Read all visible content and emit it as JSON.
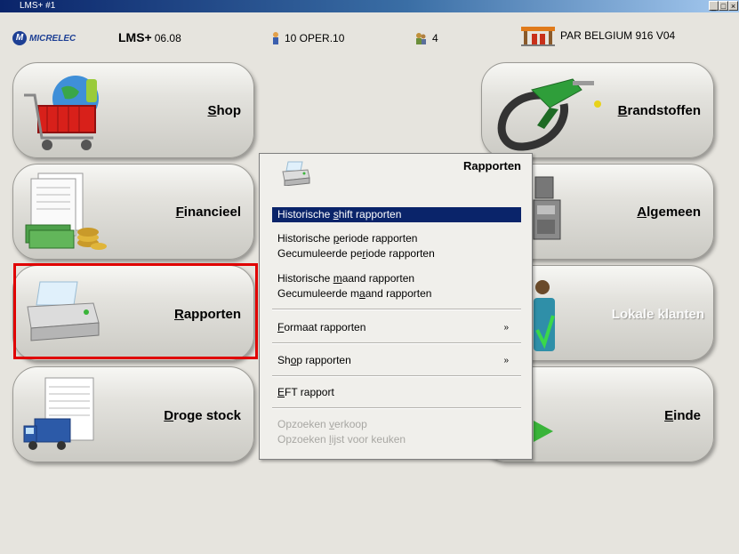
{
  "window": {
    "title": "LMS+  #1",
    "minimize": "_",
    "maximize": "□",
    "close": "×"
  },
  "header": {
    "logo_text": "MICRELEC",
    "logo_letter": "M",
    "product": "LMS+",
    "version": "06.08",
    "operator": "10  OPER.10",
    "pump_count": "4",
    "station": "PAR BELGIUM 916 V04"
  },
  "tiles": {
    "shop": {
      "pre": "",
      "key": "S",
      "post": "hop"
    },
    "financieel": {
      "pre": "",
      "key": "F",
      "post": "inancieel"
    },
    "rapporten": {
      "pre": "",
      "key": "R",
      "post": "apporten"
    },
    "droge_stock": {
      "pre": "",
      "key": "D",
      "post": "roge stock"
    },
    "brandstoffen": {
      "pre": "",
      "key": "B",
      "post": "randstoffen"
    },
    "algemeen": {
      "pre": "",
      "key": "A",
      "post": "lgemeen"
    },
    "lokale_klanten": {
      "label": "Lokale klanten"
    },
    "einde": {
      "pre": "",
      "key": "E",
      "post": "inde"
    }
  },
  "menu": {
    "title": "Rapporten",
    "items": [
      {
        "pre": "Historische ",
        "key": "s",
        "post": "hift rapporten"
      },
      {
        "pre": "Historische ",
        "key": "p",
        "post": "eriode rapporten"
      },
      {
        "pre": "Gecumuleerde pe",
        "key": "r",
        "post": "iode rapporten"
      },
      {
        "pre": "Historische ",
        "key": "m",
        "post": "aand rapporten"
      },
      {
        "pre": "Gecumuleerde m",
        "key": "a",
        "post": "and rapporten"
      },
      {
        "pre": "",
        "key": "F",
        "post": "ormaat rapporten",
        "arrow": "»"
      },
      {
        "pre": "Sh",
        "key": "o",
        "post": "p rapporten",
        "arrow": "»"
      },
      {
        "pre": "",
        "key": "E",
        "post": "FT rapport"
      },
      {
        "pre": "Opzoeken ",
        "key": "v",
        "post": "erkoop"
      },
      {
        "pre": "Opzoeken ",
        "key": "l",
        "post": "ijst voor keuken"
      }
    ]
  },
  "colors": {
    "highlight": "#0a246a",
    "selection_border": "#e00000",
    "brand": "#1d3f94"
  }
}
